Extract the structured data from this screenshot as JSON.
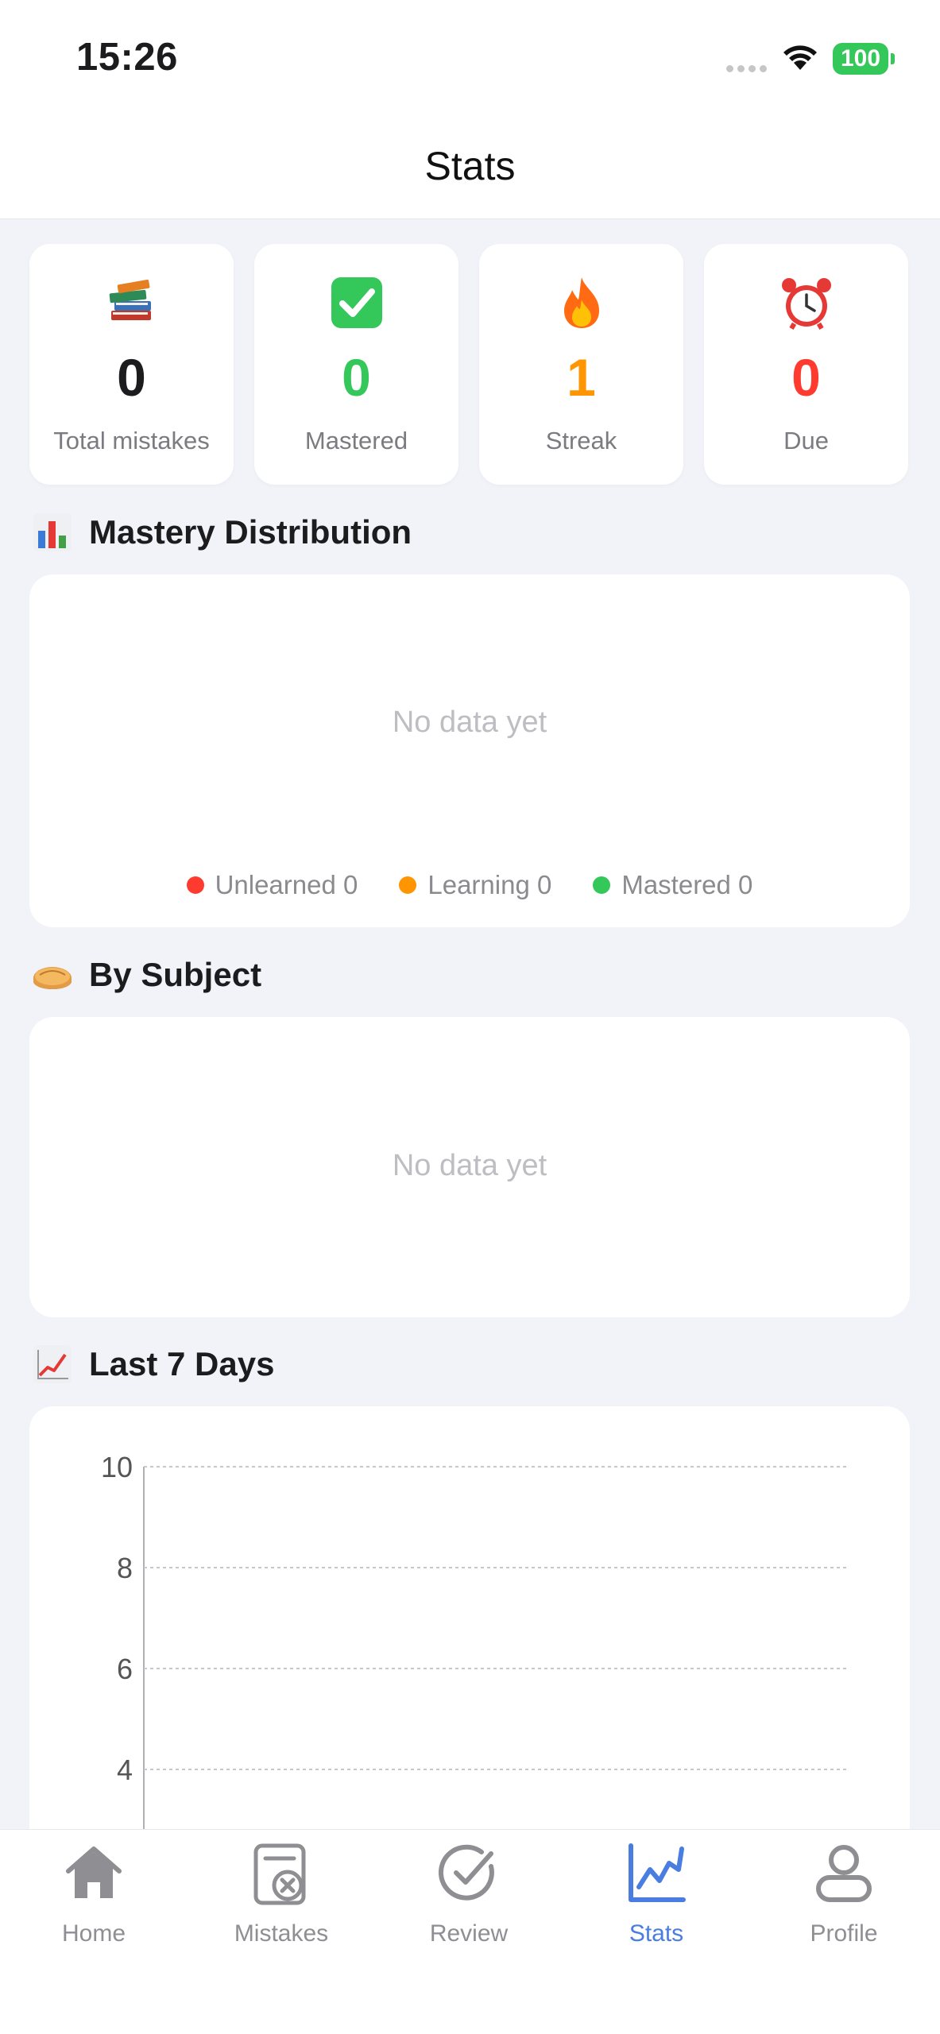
{
  "status_bar": {
    "time": "15:26",
    "battery": "100"
  },
  "nav": {
    "title": "Stats"
  },
  "summary_cards": [
    {
      "icon": "books-icon",
      "value": "0",
      "label": "Total mistakes",
      "color": "#1c1c1e"
    },
    {
      "icon": "check-mark-button-icon",
      "value": "0",
      "label": "Mastered",
      "color": "#34c759"
    },
    {
      "icon": "fire-icon",
      "value": "1",
      "label": "Streak",
      "color": "#ff9500"
    },
    {
      "icon": "alarm-clock-icon",
      "value": "0",
      "label": "Due",
      "color": "#ff3b30"
    }
  ],
  "mastery": {
    "title": "Mastery Distribution",
    "empty_text": "No data yet",
    "legend": [
      {
        "label": "Unlearned 0",
        "color": "#ff3b30"
      },
      {
        "label": "Learning 0",
        "color": "#ff9500"
      },
      {
        "label": "Mastered 0",
        "color": "#34c759"
      }
    ]
  },
  "by_subject": {
    "title": "By Subject",
    "empty_text": "No data yet"
  },
  "last7": {
    "title": "Last 7 Days",
    "chart_data": {
      "type": "line",
      "ylim": [
        0,
        10
      ],
      "y_ticks_visible": [
        "10",
        "8",
        "6",
        "4"
      ],
      "grid": true,
      "series": []
    }
  },
  "tabs": [
    {
      "label": "Home",
      "icon": "home-icon",
      "active": false
    },
    {
      "label": "Mistakes",
      "icon": "mistakes-icon",
      "active": false
    },
    {
      "label": "Review",
      "icon": "review-check-icon",
      "active": false
    },
    {
      "label": "Stats",
      "icon": "stats-chart-icon",
      "active": true
    },
    {
      "label": "Profile",
      "icon": "profile-icon",
      "active": false
    }
  ],
  "colors": {
    "accent": "#4a7de0",
    "background": "#f2f3f8"
  }
}
